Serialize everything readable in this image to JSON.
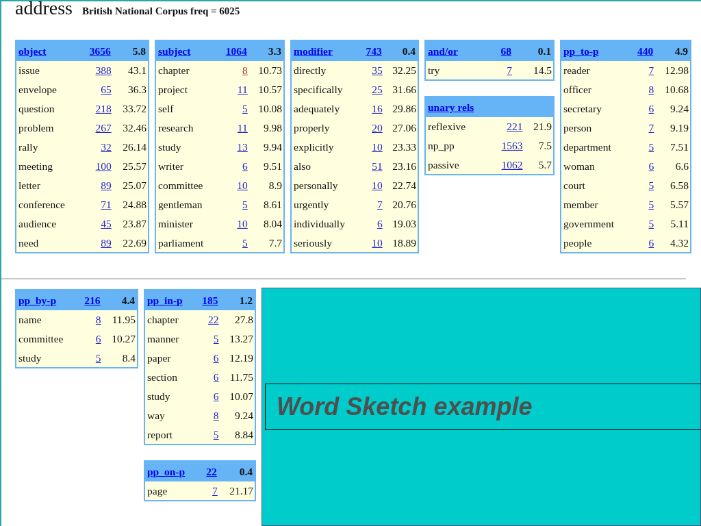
{
  "heading": {
    "word": "address",
    "corpus_info": "British National Corpus freq = 6025"
  },
  "top_columns": [
    [
      {
        "relation": "object",
        "count": "3656",
        "score": "5.8",
        "rows": [
          {
            "word": "issue",
            "freq": "388",
            "score": "43.1",
            "visited": false
          },
          {
            "word": "envelope",
            "freq": "65",
            "score": "36.3",
            "visited": false
          },
          {
            "word": "question",
            "freq": "218",
            "score": "33.72",
            "visited": false
          },
          {
            "word": "problem",
            "freq": "267",
            "score": "32.46",
            "visited": false
          },
          {
            "word": "rally",
            "freq": "32",
            "score": "26.14",
            "visited": false
          },
          {
            "word": "meeting",
            "freq": "100",
            "score": "25.57",
            "visited": false
          },
          {
            "word": "letter",
            "freq": "89",
            "score": "25.07",
            "visited": false
          },
          {
            "word": "conference",
            "freq": "71",
            "score": "24.88",
            "visited": false
          },
          {
            "word": "audience",
            "freq": "45",
            "score": "23.87",
            "visited": false
          },
          {
            "word": "need",
            "freq": "89",
            "score": "22.69",
            "visited": false
          }
        ]
      }
    ],
    [
      {
        "relation": "subject",
        "count": "1064",
        "score": "3.3",
        "rows": [
          {
            "word": "chapter",
            "freq": "8",
            "score": "10.73",
            "visited": true
          },
          {
            "word": "project",
            "freq": "11",
            "score": "10.57",
            "visited": false
          },
          {
            "word": "self",
            "freq": "5",
            "score": "10.08",
            "visited": false
          },
          {
            "word": "research",
            "freq": "11",
            "score": "9.98",
            "visited": false
          },
          {
            "word": "study",
            "freq": "13",
            "score": "9.94",
            "visited": false
          },
          {
            "word": "writer",
            "freq": "6",
            "score": "9.51",
            "visited": false
          },
          {
            "word": "committee",
            "freq": "10",
            "score": "8.9",
            "visited": false
          },
          {
            "word": "gentleman",
            "freq": "5",
            "score": "8.61",
            "visited": false
          },
          {
            "word": "minister",
            "freq": "10",
            "score": "8.04",
            "visited": false
          },
          {
            "word": "parliament",
            "freq": "5",
            "score": "7.7",
            "visited": false
          }
        ]
      }
    ],
    [
      {
        "relation": "modifier",
        "count": "743",
        "score": "0.4",
        "rows": [
          {
            "word": "directly",
            "freq": "35",
            "score": "32.25",
            "visited": false
          },
          {
            "word": "specifically",
            "freq": "25",
            "score": "31.66",
            "visited": false
          },
          {
            "word": "adequately",
            "freq": "16",
            "score": "29.86",
            "visited": false
          },
          {
            "word": "properly",
            "freq": "20",
            "score": "27.06",
            "visited": false
          },
          {
            "word": "explicitly",
            "freq": "10",
            "score": "23.33",
            "visited": false
          },
          {
            "word": "also",
            "freq": "51",
            "score": "23.16",
            "visited": false
          },
          {
            "word": "personally",
            "freq": "10",
            "score": "22.74",
            "visited": false
          },
          {
            "word": "urgently",
            "freq": "7",
            "score": "20.76",
            "visited": false
          },
          {
            "word": "individually",
            "freq": "6",
            "score": "19.03",
            "visited": false
          },
          {
            "word": "seriously",
            "freq": "10",
            "score": "18.89",
            "visited": false
          }
        ]
      }
    ],
    [
      {
        "relation": "and/or",
        "count": "68",
        "score": "0.1",
        "rows": [
          {
            "word": "try",
            "freq": "7",
            "score": "14.5",
            "visited": false
          }
        ]
      },
      {
        "relation": "unary rels",
        "rows": [
          {
            "word": "reflexive",
            "freq": "221",
            "score": "21.9",
            "visited": false
          },
          {
            "word": "np_pp",
            "freq": "1563",
            "score": "7.5",
            "visited": false
          },
          {
            "word": "passive",
            "freq": "1062",
            "score": "5.7",
            "visited": false
          }
        ]
      }
    ],
    [
      {
        "relation": "pp_to-p",
        "count": "440",
        "score": "4.9",
        "rows": [
          {
            "word": "reader",
            "freq": "7",
            "score": "12.98",
            "visited": false
          },
          {
            "word": "officer",
            "freq": "8",
            "score": "10.68",
            "visited": false
          },
          {
            "word": "secretary",
            "freq": "6",
            "score": "9.24",
            "visited": false
          },
          {
            "word": "person",
            "freq": "7",
            "score": "9.19",
            "visited": false
          },
          {
            "word": "department",
            "freq": "5",
            "score": "7.51",
            "visited": false
          },
          {
            "word": "woman",
            "freq": "6",
            "score": "6.6",
            "visited": false
          },
          {
            "word": "court",
            "freq": "5",
            "score": "6.58",
            "visited": false
          },
          {
            "word": "member",
            "freq": "5",
            "score": "5.57",
            "visited": false
          },
          {
            "word": "government",
            "freq": "5",
            "score": "5.11",
            "visited": false
          },
          {
            "word": "people",
            "freq": "6",
            "score": "4.32",
            "visited": false
          }
        ]
      }
    ]
  ],
  "bottom_columns": [
    [
      {
        "relation": "pp_by-p",
        "count": "216",
        "score": "4.4",
        "rows": [
          {
            "word": "name",
            "freq": "8",
            "score": "11.95",
            "visited": false
          },
          {
            "word": "committee",
            "freq": "6",
            "score": "10.27",
            "visited": false
          },
          {
            "word": "study",
            "freq": "5",
            "score": "8.4",
            "visited": false
          }
        ]
      }
    ],
    [
      {
        "relation": "pp_in-p",
        "count": "185",
        "score": "1.2",
        "rows": [
          {
            "word": "chapter",
            "freq": "22",
            "score": "27.8",
            "visited": false
          },
          {
            "word": "manner",
            "freq": "5",
            "score": "13.27",
            "visited": false
          },
          {
            "word": "paper",
            "freq": "6",
            "score": "12.19",
            "visited": false
          },
          {
            "word": "section",
            "freq": "6",
            "score": "11.75",
            "visited": false
          },
          {
            "word": "study",
            "freq": "6",
            "score": "10.07",
            "visited": false
          },
          {
            "word": "way",
            "freq": "8",
            "score": "9.24",
            "visited": false
          },
          {
            "word": "report",
            "freq": "5",
            "score": "8.84",
            "visited": false
          }
        ]
      },
      {
        "relation": "pp_on-p",
        "count": "22",
        "score": "0.4",
        "rows": [
          {
            "word": "page",
            "freq": "7",
            "score": "21.17",
            "visited": false
          }
        ]
      }
    ]
  ],
  "slide_caption": "Word Sketch example"
}
